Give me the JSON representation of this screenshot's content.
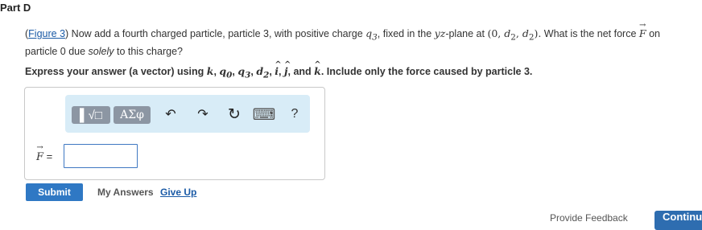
{
  "part": {
    "title": "Part D"
  },
  "question": {
    "figure_link": "Figure 3",
    "text_a": ") Now add a fourth charged particle, particle 3, with positive charge ",
    "charge": "q",
    "charge_sub": "3",
    "text_b": ", fixed in the ",
    "plane": "yz",
    "text_c": "-plane at ",
    "coords_open": "(0, ",
    "d": "d",
    "d_sub": "2",
    "comma": ", ",
    "coords_close": ").",
    "text_d": " What is the net force ",
    "force_symbol": "F",
    "text_e": " on particle 0 due ",
    "solely": "solely",
    "text_f": " to this charge?"
  },
  "instruction": {
    "text_a": "Express your answer (a vector) using ",
    "k": "k",
    "q": "q",
    "sub0": "0",
    "sub3": "3",
    "d": "d",
    "sub2": "2",
    "i": "i",
    "j": "j",
    "kk": "k",
    "sep": ", ",
    "and": ", and ",
    "text_b": ". Include only the force caused by particle 3."
  },
  "toolbar": {
    "templates_label": "▌√□",
    "greek_label": "ΑΣφ",
    "undo_glyph": "↶",
    "redo_glyph": "↷",
    "reset_glyph": "↻",
    "keyboard_glyph": "⌨",
    "help_glyph": "?"
  },
  "answer": {
    "label": "F",
    "equals": " =",
    "value": ""
  },
  "actions": {
    "submit": "Submit",
    "my_answers": "My Answers",
    "give_up": "Give Up",
    "feedback": "Provide Feedback",
    "continue": "Continue"
  },
  "colors": {
    "link": "#1a5aa6",
    "submit_bg": "#2f78c4",
    "toolbar_bg": "#d8ecf7",
    "toolbar_button": "#8c96a3",
    "input_border": "#3f78c2"
  }
}
